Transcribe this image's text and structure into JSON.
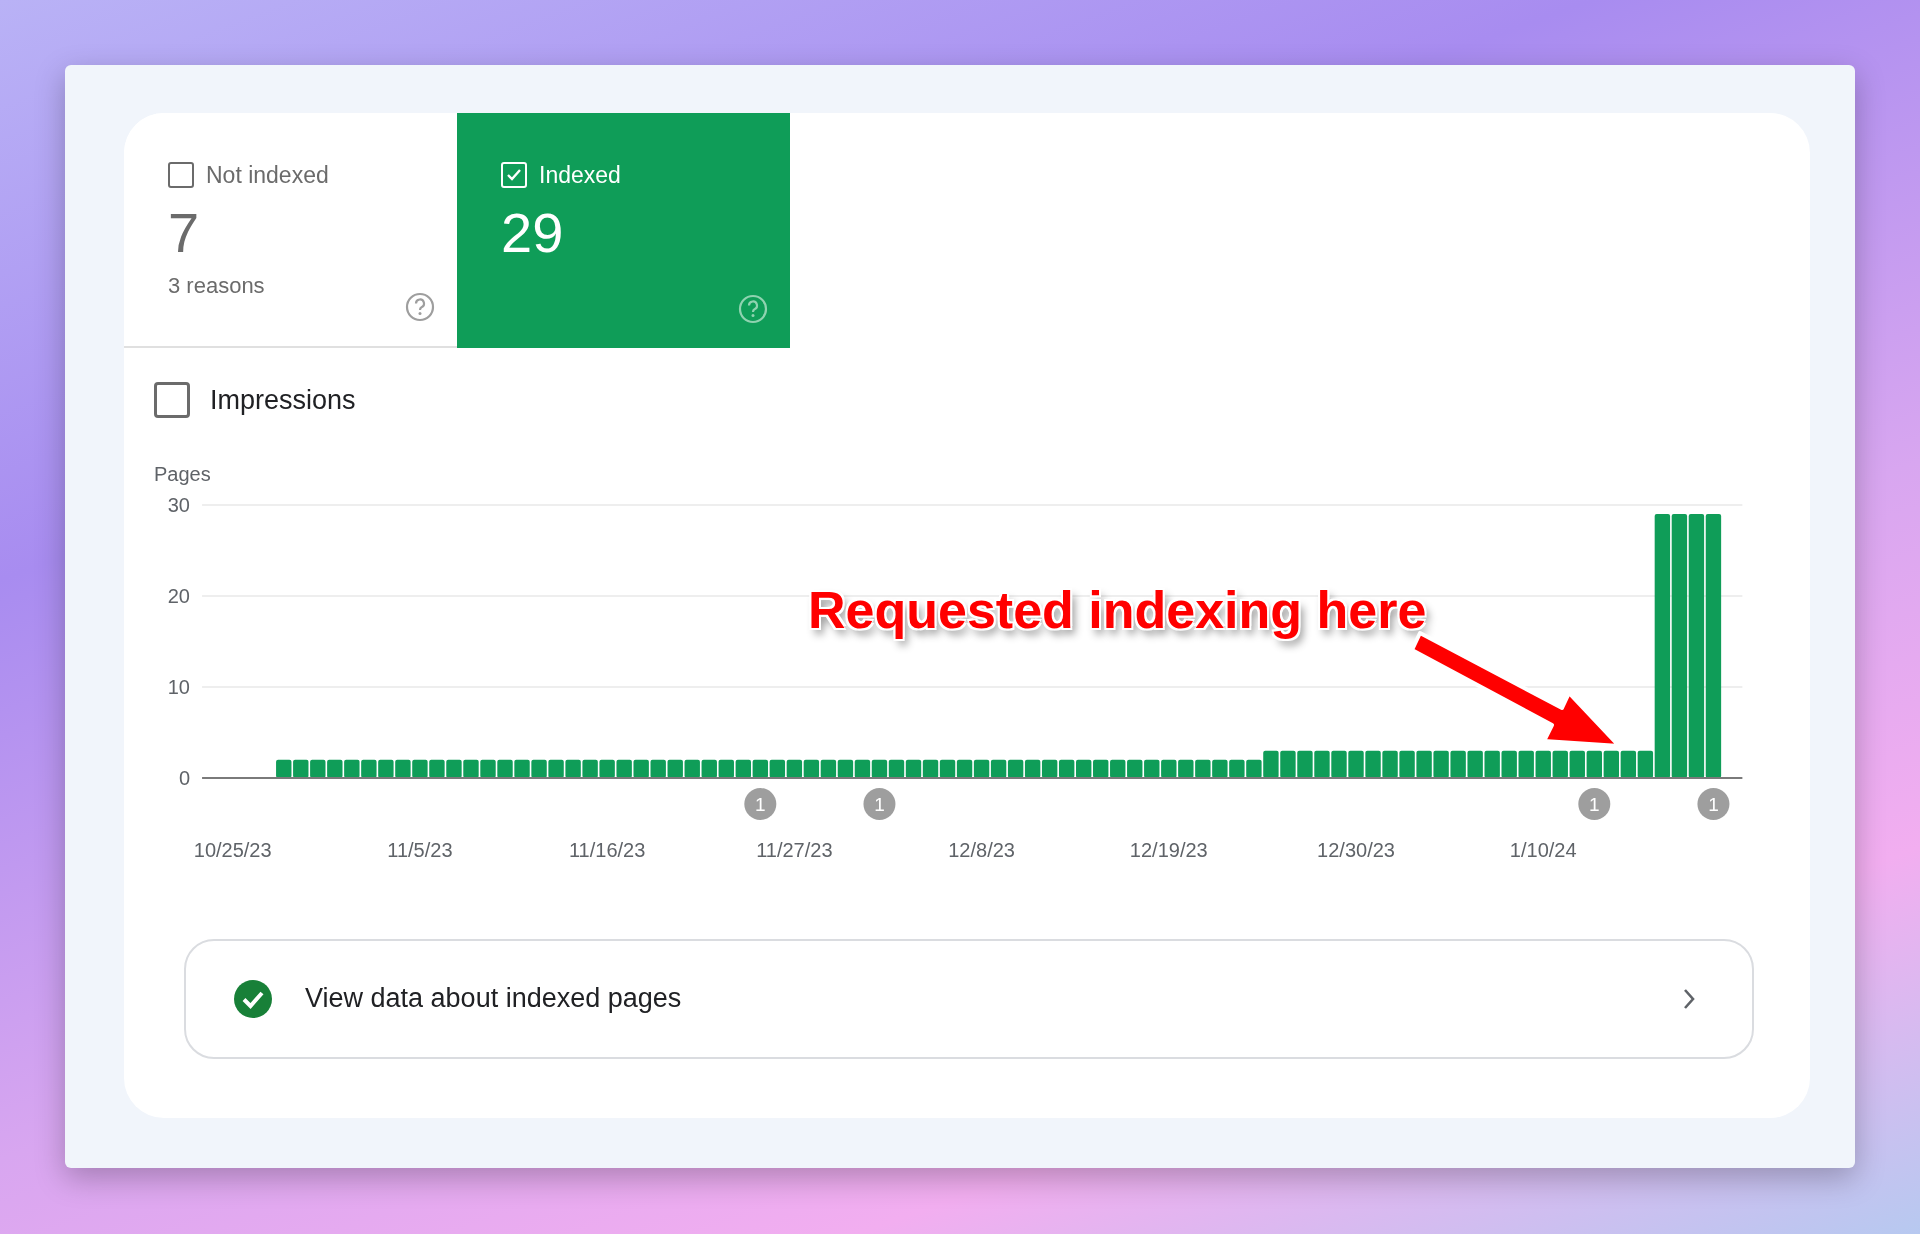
{
  "cards": [
    {
      "label": "Not indexed",
      "value": "7",
      "sublabel": "3 reasons",
      "selected": false
    },
    {
      "label": "Indexed",
      "value": "29",
      "selected": true
    }
  ],
  "impressions": {
    "label": "Impressions",
    "checked": false
  },
  "chart": {
    "chart_data": {
      "type": "bar",
      "ylabel": "Pages",
      "categories": [
        "10/25/23",
        null,
        null,
        null,
        null,
        null,
        null,
        null,
        null,
        null,
        null,
        "11/5/23",
        null,
        null,
        null,
        null,
        null,
        null,
        null,
        null,
        null,
        null,
        "11/16/23",
        null,
        null,
        null,
        null,
        null,
        null,
        null,
        null,
        null,
        null,
        "11/27/23",
        null,
        null,
        null,
        null,
        null,
        null,
        null,
        null,
        null,
        null,
        "12/8/23",
        null,
        null,
        null,
        null,
        null,
        null,
        null,
        null,
        null,
        null,
        "12/19/23",
        null,
        null,
        null,
        null,
        null,
        null,
        null,
        null,
        null,
        null,
        "12/30/23",
        null,
        null,
        null,
        null,
        null,
        null,
        null,
        null,
        null,
        null,
        "1/10/24",
        null,
        null,
        null,
        null,
        null,
        null,
        null,
        null,
        null,
        null
      ],
      "series": [
        {
          "color": "#0f9d58",
          "values": [
            null,
            null,
            null,
            2,
            2,
            2,
            2,
            2,
            2,
            2,
            2,
            2,
            2,
            2,
            2,
            2,
            2,
            2,
            2,
            2,
            2,
            2,
            2,
            2,
            2,
            2,
            2,
            2,
            2,
            2,
            2,
            2,
            2,
            2,
            2,
            2,
            2,
            2,
            2,
            2,
            2,
            2,
            2,
            2,
            2,
            2,
            2,
            2,
            2,
            2,
            2,
            2,
            2,
            2,
            2,
            2,
            2,
            2,
            2,
            2,
            2,
            3,
            3,
            3,
            3,
            3,
            3,
            3,
            3,
            3,
            3,
            3,
            3,
            3,
            3,
            3,
            3,
            3,
            3,
            3,
            3,
            3,
            3,
            3,
            29,
            29,
            29,
            29
          ]
        }
      ],
      "ylim": [
        0,
        30
      ],
      "yticks": [
        0,
        10,
        20,
        30
      ],
      "annotations": [
        "1",
        "1",
        "1",
        "1"
      ]
    }
  },
  "overlay": {
    "text": "Requested indexing here"
  },
  "link": {
    "label": "View data about indexed pages"
  }
}
